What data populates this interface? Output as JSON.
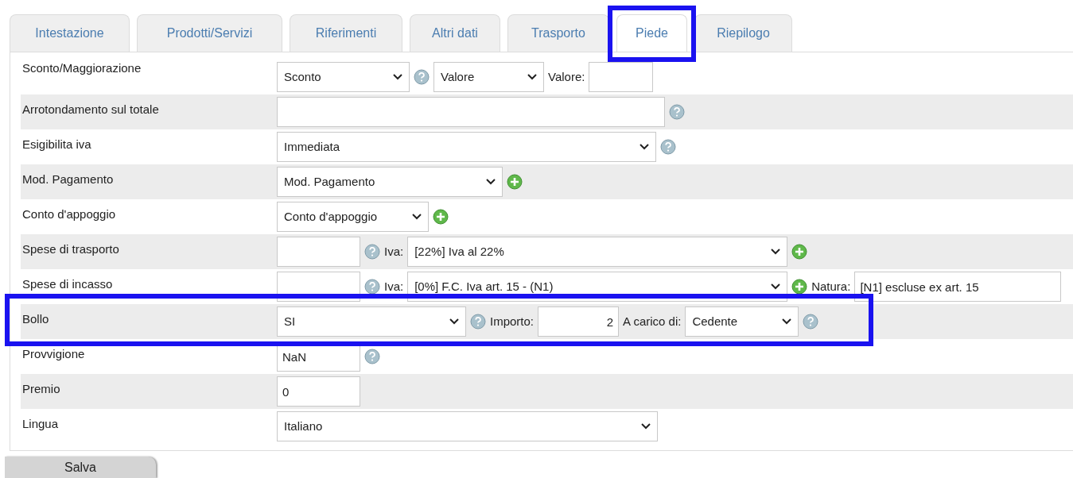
{
  "tabs": [
    {
      "label": "Intestazione",
      "selected": false,
      "highlighted": false
    },
    {
      "label": "Prodotti/Servizi",
      "selected": false,
      "highlighted": false
    },
    {
      "label": "Riferimenti",
      "selected": false,
      "highlighted": false
    },
    {
      "label": "Altri dati",
      "selected": false,
      "highlighted": false
    },
    {
      "label": "Trasporto",
      "selected": false,
      "highlighted": false
    },
    {
      "label": "Piede",
      "selected": true,
      "highlighted": true
    },
    {
      "label": "Riepilogo",
      "selected": false,
      "highlighted": false
    }
  ],
  "rows": [
    {
      "label": "Sconto/Maggiorazione",
      "highlighted": false,
      "controls": [
        {
          "kind": "select",
          "value": "Sconto"
        },
        {
          "kind": "help"
        },
        {
          "kind": "select",
          "value": "Valore"
        },
        {
          "kind": "text",
          "text": "Valore:"
        },
        {
          "kind": "input"
        }
      ]
    },
    {
      "label": "Arrotondamento sul totale",
      "highlighted": false,
      "controls": [
        {
          "kind": "input"
        },
        {
          "kind": "help"
        }
      ]
    },
    {
      "label": "Esigibilita iva",
      "highlighted": false,
      "controls": [
        {
          "kind": "select",
          "value": "Immediata"
        },
        {
          "kind": "help"
        }
      ]
    },
    {
      "label": "Mod. Pagamento",
      "highlighted": false,
      "controls": [
        {
          "kind": "select",
          "value": "Mod. Pagamento"
        },
        {
          "kind": "add"
        }
      ]
    },
    {
      "label": "Conto d'appoggio",
      "highlighted": false,
      "controls": [
        {
          "kind": "select",
          "value": "Conto d'appoggio"
        },
        {
          "kind": "add"
        }
      ]
    },
    {
      "label": "Spese di trasporto",
      "highlighted": false,
      "controls": [
        {
          "kind": "input"
        },
        {
          "kind": "help"
        },
        {
          "kind": "text",
          "text": "Iva:"
        },
        {
          "kind": "select",
          "value": "[22%] Iva al 22%"
        },
        {
          "kind": "add"
        }
      ]
    },
    {
      "label": "Spese di incasso",
      "highlighted": false,
      "controls": [
        {
          "kind": "input"
        },
        {
          "kind": "help"
        },
        {
          "kind": "text",
          "text": "Iva:"
        },
        {
          "kind": "select",
          "value": "[0%] F.C. Iva art. 15 - (N1)"
        },
        {
          "kind": "add"
        },
        {
          "kind": "text",
          "text": "Natura:"
        },
        {
          "kind": "input",
          "value": "[N1] escluse ex art. 15"
        }
      ]
    },
    {
      "label": "Bollo",
      "highlighted": true,
      "controls": [
        {
          "kind": "select",
          "value": "SI"
        },
        {
          "kind": "help"
        },
        {
          "kind": "text",
          "text": "Importo:"
        },
        {
          "kind": "input",
          "value": "2"
        },
        {
          "kind": "text",
          "text": "A carico di:"
        },
        {
          "kind": "select",
          "value": "Cedente"
        },
        {
          "kind": "help"
        }
      ]
    },
    {
      "label": "Provvigione",
      "highlighted": false,
      "controls": [
        {
          "kind": "input",
          "value": "NaN"
        },
        {
          "kind": "help"
        }
      ]
    },
    {
      "label": "Premio",
      "highlighted": false,
      "controls": [
        {
          "kind": "input",
          "value": "0"
        }
      ]
    },
    {
      "label": "Lingua",
      "highlighted": false,
      "controls": [
        {
          "kind": "select",
          "value": "Italiano"
        }
      ]
    }
  ],
  "save_button": "Salva"
}
